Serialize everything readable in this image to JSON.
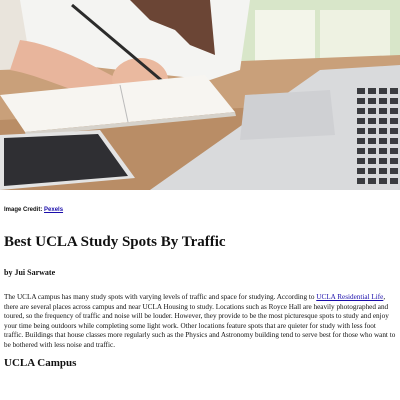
{
  "hero": {
    "alt": "Person writing in a notebook beside a laptop and a phone"
  },
  "credit": {
    "prefix": "Image Credit: ",
    "link_text": "Pexels"
  },
  "article": {
    "title": "Best UCLA Study Spots By Traffic",
    "byline": "by Jui Sarwate",
    "intro_before_link": "The UCLA campus has many study spots with varying levels of traffic and space for studying. According to ",
    "intro_link": "UCLA Residential Life",
    "intro_after_link": ", there are several places across campus and near UCLA Housing to study. Locations such as Royce Hall are heavily photographed and toured, so the frequency of traffic and noise will be louder. However, they provide to be the most picturesque spots to study and enjoy your time being outdoors while completing some light work. Other locations feature spots that are quieter for study with less foot traffic. Buildings that house classes more regularly such as the Physics and Astronomy building tend to serve best for those who want to be bothered with less noise and traffic.",
    "section_heading": "UCLA Campus"
  },
  "colors": {
    "link": "#1a0dab",
    "text": "#111111"
  }
}
